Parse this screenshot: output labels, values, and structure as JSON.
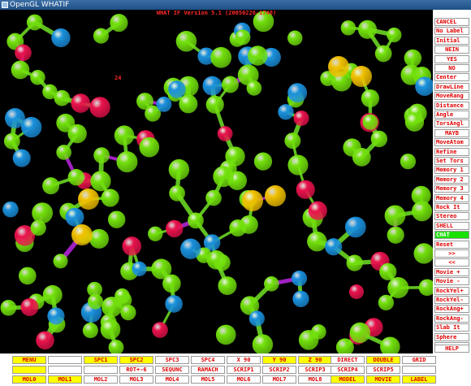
{
  "window": {
    "title": "OpenGL WHATIF",
    "icon": "opengl-app-icon"
  },
  "viewport": {
    "title": "WHAT IF Version 5.1 (20050226-1740)",
    "labels": [
      "24"
    ],
    "colors": {
      "background": "#000000",
      "carbon": "#72e00c",
      "oxygen": "#e8124c",
      "nitrogen": "#1a90dc",
      "sulfur": "#f0c000",
      "bond": "#60c020",
      "accent": "#a020c0"
    }
  },
  "side_menu": {
    "items": [
      {
        "label": "CANCEL",
        "style": "normal"
      },
      {
        "label": "No Label",
        "style": "normal"
      },
      {
        "label": "Initial",
        "style": "normal"
      },
      {
        "label": "NEIN",
        "style": "center"
      },
      {
        "label": "YES",
        "style": "center"
      },
      {
        "label": "NO",
        "style": "center"
      },
      {
        "label": "Center",
        "style": "normal"
      },
      {
        "label": "DrawLine",
        "style": "normal"
      },
      {
        "label": "MoveRang",
        "style": "normal"
      },
      {
        "label": "Distance",
        "style": "normal"
      },
      {
        "label": "Angle",
        "style": "normal"
      },
      {
        "label": "TorsAngl",
        "style": "normal"
      },
      {
        "label": "MAYB",
        "style": "center"
      },
      {
        "label": "MoveAtom",
        "style": "normal"
      },
      {
        "label": "Refine",
        "style": "normal"
      },
      {
        "label": "Set Tors",
        "style": "normal"
      },
      {
        "label": "Memory 1",
        "style": "normal"
      },
      {
        "label": "Memory 2",
        "style": "normal"
      },
      {
        "label": "Memory 3",
        "style": "normal"
      },
      {
        "label": "Memory 4",
        "style": "normal"
      },
      {
        "label": "Rock It",
        "style": "normal"
      },
      {
        "label": "Stereo",
        "style": "normal"
      },
      {
        "label": "SHELL",
        "style": "normal"
      },
      {
        "label": "CHAT",
        "style": "green"
      },
      {
        "label": "Reset",
        "style": "normal"
      },
      {
        "label": ">>",
        "style": "center"
      },
      {
        "label": "<<",
        "style": "center"
      },
      {
        "label": "Movie +",
        "style": "normal"
      },
      {
        "label": "Movie -",
        "style": "normal"
      },
      {
        "label": "RockYel+",
        "style": "normal"
      },
      {
        "label": "RockYel-",
        "style": "normal"
      },
      {
        "label": "RockAng+",
        "style": "normal"
      },
      {
        "label": "RockAng-",
        "style": "normal"
      },
      {
        "label": "Slab It",
        "style": "normal"
      },
      {
        "label": "Sphere",
        "style": "normal"
      },
      {
        "label": "",
        "style": "normal"
      },
      {
        "label": "HELP",
        "style": "center"
      }
    ]
  },
  "bottom_bar": {
    "rows": [
      [
        {
          "label": "MENU",
          "hl": true
        },
        {
          "label": "",
          "hl": false
        },
        {
          "label": "SPC1",
          "hl": true
        },
        {
          "label": "SPC2",
          "hl": true
        },
        {
          "label": "SPC3",
          "hl": false
        },
        {
          "label": "SPC4",
          "hl": false
        },
        {
          "label": "X 90",
          "hl": false
        },
        {
          "label": "Y 90",
          "hl": true
        },
        {
          "label": "Z 90",
          "hl": true
        },
        {
          "label": "DIRECT",
          "hl": false
        },
        {
          "label": "DOUBLE",
          "hl": true
        },
        {
          "label": "GRID",
          "hl": false
        }
      ],
      [
        {
          "label": "",
          "hl": true
        },
        {
          "label": "",
          "hl": false
        },
        {
          "label": "",
          "hl": false
        },
        {
          "label": "ROT+-6",
          "hl": false
        },
        {
          "label": "SEQUNC",
          "hl": false
        },
        {
          "label": "RAMACH",
          "hl": false
        },
        {
          "label": "SCRIP1",
          "hl": false
        },
        {
          "label": "SCRIP2",
          "hl": false
        },
        {
          "label": "SCRIP3",
          "hl": false
        },
        {
          "label": "SCRIP4",
          "hl": false
        },
        {
          "label": "SCRIP5",
          "hl": false
        },
        {
          "label": "",
          "hl": false
        }
      ],
      [
        {
          "label": "MOL0",
          "hl": true
        },
        {
          "label": "MOL1",
          "hl": true
        },
        {
          "label": "MOL2",
          "hl": false
        },
        {
          "label": "MOL3",
          "hl": false
        },
        {
          "label": "MOL4",
          "hl": false
        },
        {
          "label": "MOL5",
          "hl": false
        },
        {
          "label": "MOL6",
          "hl": false
        },
        {
          "label": "MOL7",
          "hl": false
        },
        {
          "label": "MOL8",
          "hl": false
        },
        {
          "label": "MODEL",
          "hl": true
        },
        {
          "label": "MOVIE",
          "hl": true
        },
        {
          "label": "LABEL",
          "hl": true
        }
      ]
    ]
  }
}
